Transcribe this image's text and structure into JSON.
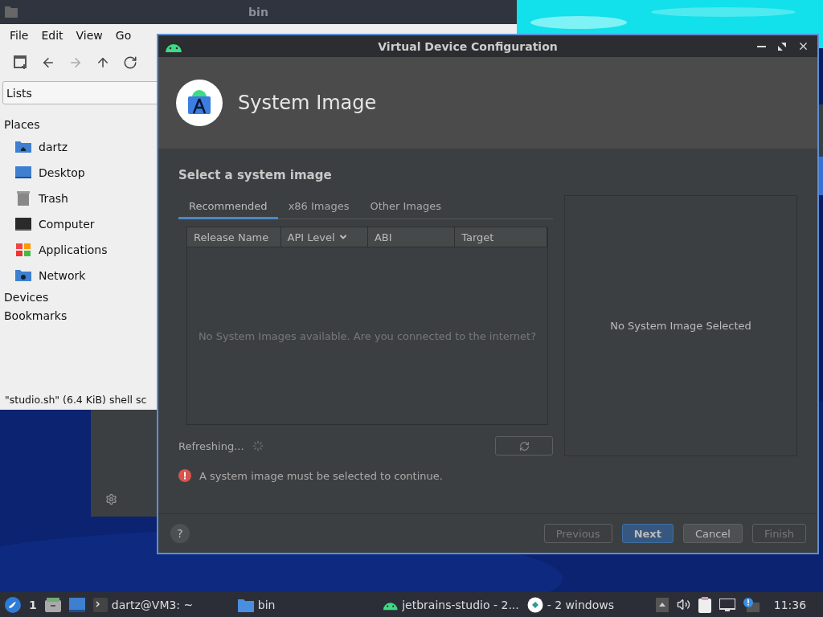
{
  "file_manager": {
    "title": "bin",
    "menu": [
      "File",
      "Edit",
      "View",
      "Go"
    ],
    "side_pane_mode": "Lists",
    "sections": [
      {
        "label": "Places",
        "items": [
          {
            "label": "dartz",
            "kind": "home"
          },
          {
            "label": "Desktop",
            "kind": "desktop"
          },
          {
            "label": "Trash",
            "kind": "trash"
          },
          {
            "label": "Computer",
            "kind": "computer"
          },
          {
            "label": "Applications",
            "kind": "apps"
          },
          {
            "label": "Network",
            "kind": "network"
          }
        ]
      },
      {
        "label": "Devices"
      },
      {
        "label": "Bookmarks"
      }
    ],
    "status": "\"studio.sh\" (6.4 KiB) shell sc"
  },
  "dialog": {
    "title": "Virtual Device Configuration",
    "header": "System Image",
    "heading": "Select a system image",
    "tabs": [
      {
        "label": "Recommended",
        "selected": true
      },
      {
        "label": "x86 Images",
        "selected": false
      },
      {
        "label": "Other Images",
        "selected": false
      }
    ],
    "table": {
      "columns": [
        {
          "label": "Release Name",
          "sorted": false
        },
        {
          "label": "API Level",
          "sorted": true
        },
        {
          "label": "ABI",
          "sorted": false
        },
        {
          "label": "Target",
          "sorted": false
        }
      ],
      "empty_message": "No System Images available. Are you connected to the internet?"
    },
    "details": "No System Image Selected",
    "help_label": "?",
    "status": "Refreshing...",
    "error": "A system image must be selected to continue.",
    "buttons": [
      {
        "label": "Previous",
        "disabled": true,
        "default": false
      },
      {
        "label": "Next",
        "disabled": false,
        "default": true
      },
      {
        "label": "Cancel",
        "disabled": false,
        "default": false
      },
      {
        "label": "Finish",
        "disabled": true,
        "default": false
      }
    ]
  },
  "taskbar": {
    "workspace": "1",
    "tasks": [
      {
        "label": "dartz@VM3: ~",
        "kind": "terminal"
      },
      {
        "label": "bin",
        "kind": "folder"
      },
      {
        "label": "jetbrains-studio - 2...",
        "kind": "android"
      },
      {
        "label": "- 2 windows",
        "kind": "app"
      }
    ],
    "clock": "11:36"
  }
}
